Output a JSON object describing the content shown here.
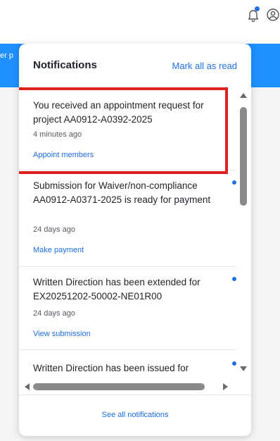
{
  "page": {
    "background_text": "er p"
  },
  "topbar": {
    "bell_icon": "notification-bell-icon",
    "user_icon": "user-account-icon"
  },
  "notifications": {
    "title": "Notifications",
    "mark_all_label": "Mark all as read",
    "items": [
      {
        "title": "You received an appointment request for project AA0912-A0392-2025",
        "time": "4 minutes ago",
        "action": "Appoint members",
        "unread": false
      },
      {
        "title": "Submission for Waiver/non-compliance AA0912-A0371-2025 is ready for payment",
        "time": "24 days ago",
        "action": "Make payment",
        "unread": true
      },
      {
        "title": "Written Direction has been extended for EX20251202-50002-NE01R00",
        "time": "24 days ago",
        "action": "View submission",
        "unread": true
      },
      {
        "title": "Written Direction has been issued for",
        "time": "",
        "action": "",
        "unread": true
      }
    ],
    "see_all_label": "See all notifications"
  },
  "colors": {
    "accent": "#1e6fe3",
    "page_bar": "#1e90ff",
    "highlight": "#e02020"
  }
}
